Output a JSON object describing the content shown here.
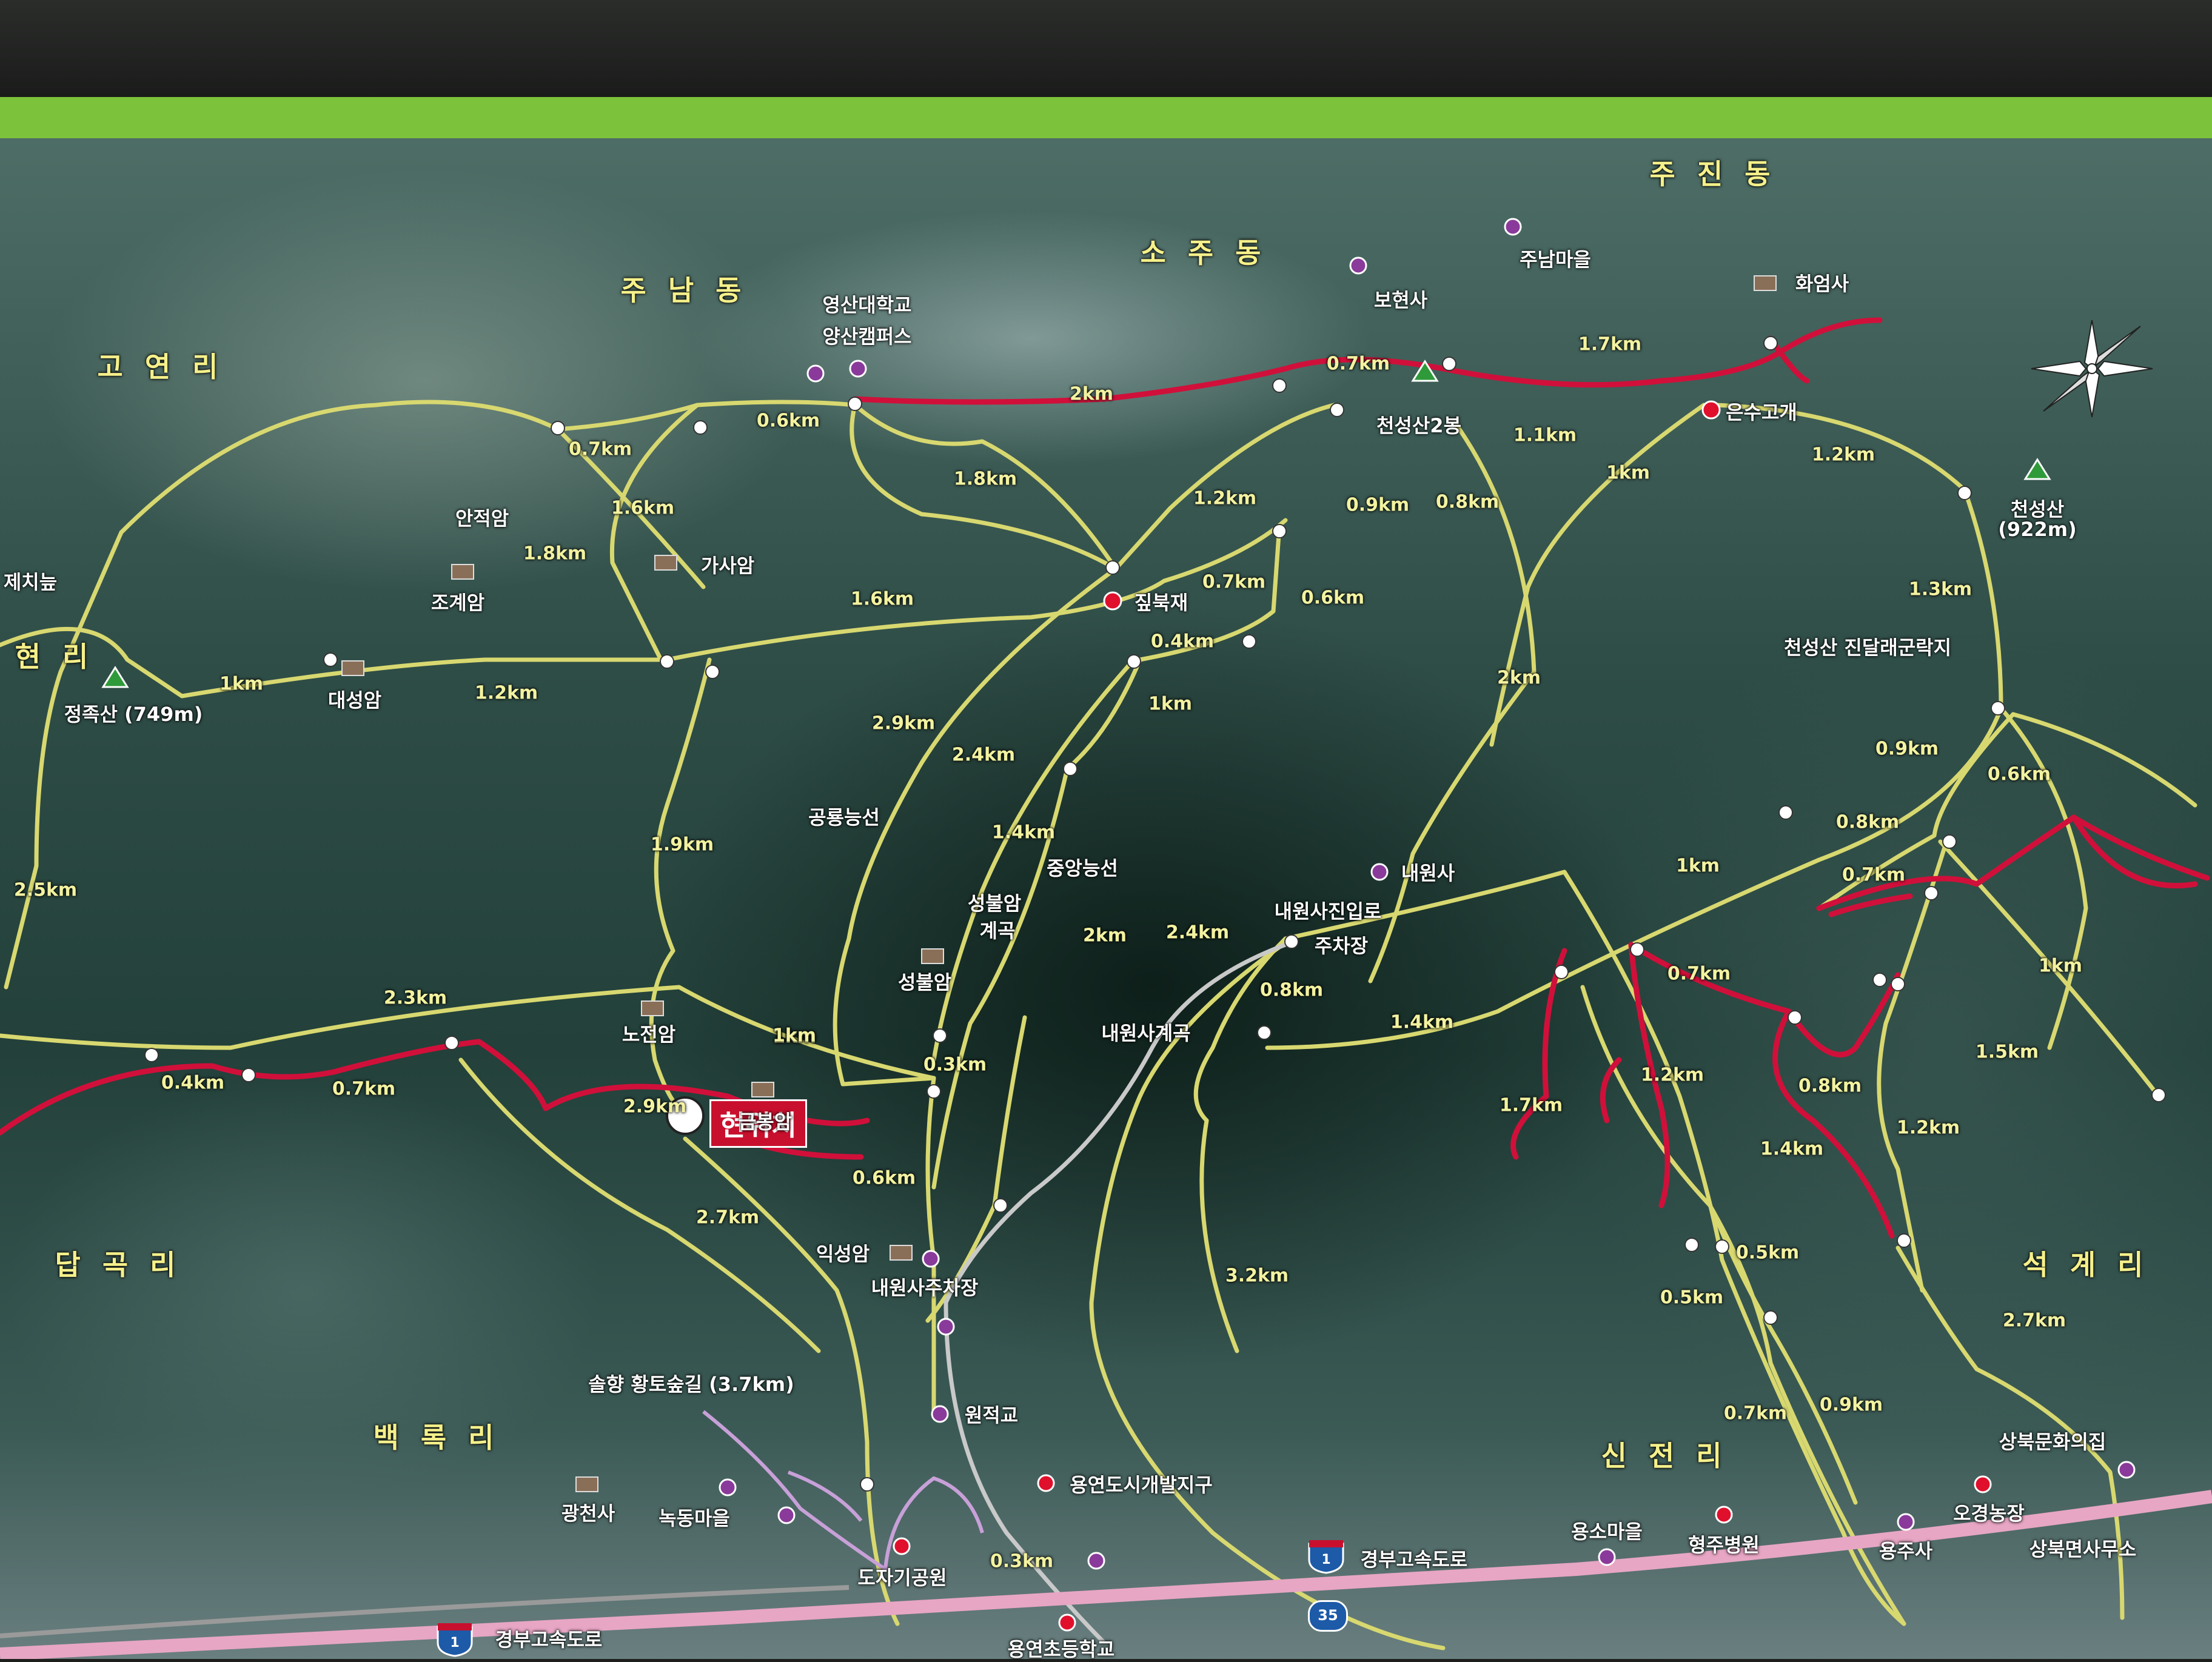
{
  "map": {
    "current_location": "현위치",
    "districts": {
      "jujin": "주 진 동",
      "soju": "소 주 동",
      "junam": "주 남 동",
      "goyeon": "고 연 리",
      "hyeon": "현 리",
      "dapgok": "답 곡 리",
      "baekrok": "백 록 리",
      "sinjeon": "신 전 리",
      "seokgye": "석 계 리"
    },
    "peaks": {
      "cheonseong2": "천성산2봉",
      "cheonseong": "천성산",
      "cheonseong_elev": "(922m)",
      "jeongjok": "정족산 (749m)"
    },
    "places": {
      "univ_line1": "영산대학교",
      "univ_line2": "양산캠퍼스",
      "bohyeonsa": "보현사",
      "junam_maeul": "주남마을",
      "hwaeomsa": "화엄사",
      "eunsu_gogae": "은수고개",
      "anjeokam": "안적암",
      "gasaam": "가사암",
      "jogyeam": "조계암",
      "jeche": "제치늪",
      "jipbukjae": "짚북재",
      "daeseongam": "대성암",
      "azalea": "천성산 진달래군락지",
      "gongnyong": "공룡능선",
      "jungang": "중앙능선",
      "naewonsa": "내원사",
      "naewonsa_road": "내원사진입로",
      "parking": "주차장",
      "seongbulam_valley_1": "성불암",
      "seongbulam_valley_2": "계곡",
      "seongbulam": "성불암",
      "nojeonam": "노전암",
      "naewonsa_valley": "내원사계곡",
      "geumbongam": "금봉암",
      "ikseongam": "익성암",
      "naewonsa_parking": "내원사주차장",
      "solhyang_trail": "솔향 황토숲길 (3.7km)",
      "wonjeokgyo": "원적교",
      "yongyeon_dev": "용연도시개발지구",
      "gwangcheonsa": "광천사",
      "nokdong": "녹동마을",
      "dojagi_park": "도자기공원",
      "yongyeon_school": "용연초등학교",
      "yongso": "용소마을",
      "hyeongju_hosp": "형주병원",
      "yongjusa": "용주사",
      "ogyeong_farm": "오경농장",
      "sangbuk_clinic": "상북문화의집",
      "sangbuk_office": "상북면사무소"
    },
    "roads": {
      "expressway": "경부고속도로",
      "expressway_b": "경부고속도로",
      "shield_no": "1",
      "shield_no_b": "1",
      "route35": "35"
    },
    "distances": [
      "2km",
      "0.7km",
      "1.7km",
      "1.1km",
      "0.6km",
      "0.7km",
      "1.8km",
      "1.2km",
      "0.9km",
      "0.8km",
      "1km",
      "1.2km",
      "1.6km",
      "1.8km",
      "1.6km",
      "0.7km",
      "0.6km",
      "0.4km",
      "1.3km",
      "1km",
      "1.2km",
      "2km",
      "2.9km",
      "2.4km",
      "1km",
      "1.9km",
      "1.4km",
      "0.9km",
      "0.6km",
      "2.5km",
      "0.8km",
      "1km",
      "0.7km",
      "2km",
      "2.4km",
      "1km",
      "2.3km",
      "0.8km",
      "1.4km",
      "0.7km",
      "1km",
      "0.4km",
      "0.7km",
      "2.9km",
      "1km",
      "0.3km",
      "1.7km",
      "1.2km",
      "0.8km",
      "1.5km",
      "0.6km",
      "1.4km",
      "1.2km",
      "2.7km",
      "0.5km",
      "0.5km",
      "3.2km",
      "2.7km",
      "0.7km",
      "0.9km",
      "0.3km"
    ]
  },
  "colors": {
    "trail": "#d8d870",
    "hiking_red": "#d0103a",
    "soft_trail": "#c8a0d8",
    "frame": "#7cc23a",
    "marker_red": "#e0102c",
    "marker_purple": "#8a3a9a"
  }
}
